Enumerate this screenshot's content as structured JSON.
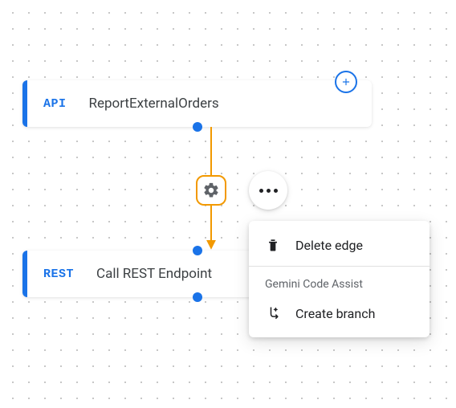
{
  "node_top": {
    "tag": "API",
    "label": "ReportExternalOrders"
  },
  "node_bottom": {
    "tag": "REST",
    "label": "Call REST Endpoint"
  },
  "context_menu": {
    "delete_label": "Delete edge",
    "section_label": "Gemini Code Assist",
    "create_branch_label": "Create branch"
  }
}
